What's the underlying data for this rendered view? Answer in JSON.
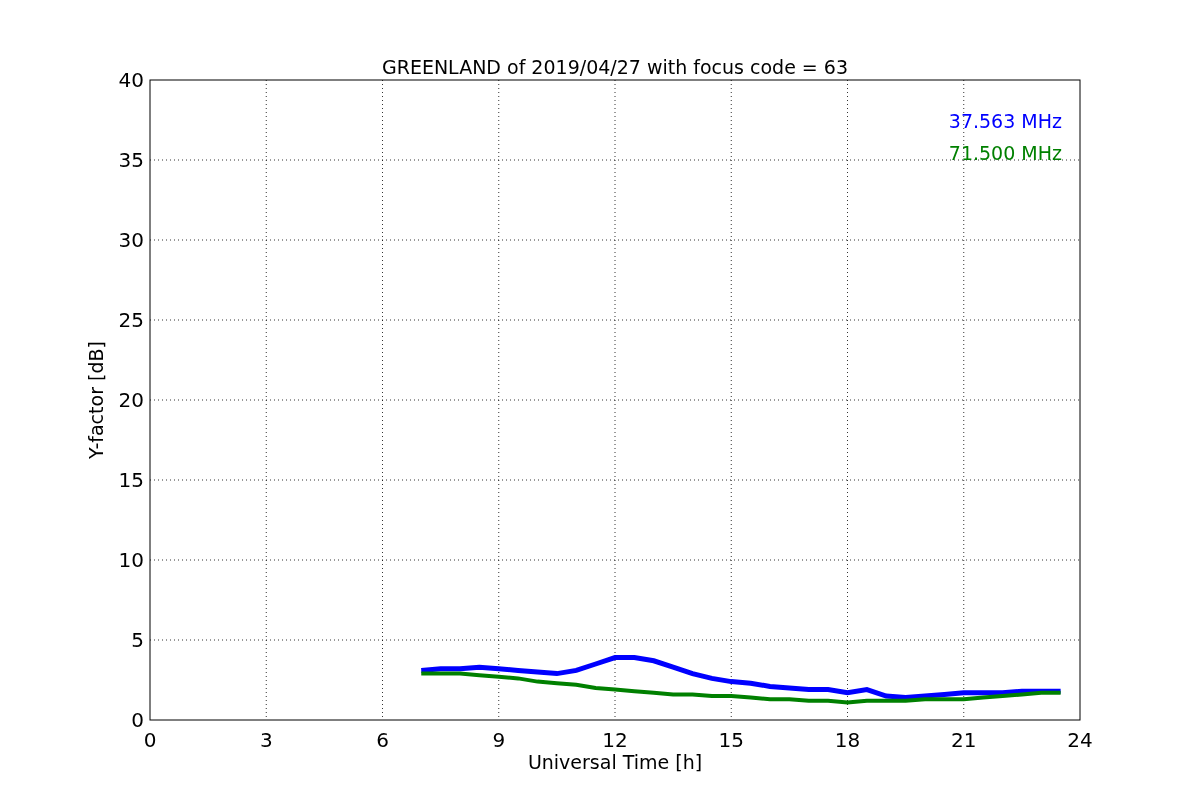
{
  "figure": {
    "chart_data": {
      "type": "line",
      "title": "GREENLAND of 2019/04/27 with focus code = 63",
      "xlabel": "Universal Time [h]",
      "ylabel": "Y-factor [dB]",
      "x": [
        7,
        7.5,
        8,
        8.5,
        9,
        9.5,
        10,
        10.5,
        11,
        11.5,
        12,
        12.5,
        13,
        13.5,
        14,
        14.5,
        15,
        15.5,
        16,
        16.5,
        17,
        17.5,
        18,
        18.5,
        19,
        19.5,
        20,
        20.5,
        21,
        21.5,
        22,
        22.5,
        23,
        23.5
      ],
      "series": [
        {
          "name": "37.563 MHz",
          "color": "#0000ff",
          "values": [
            3.1,
            3.2,
            3.2,
            3.3,
            3.2,
            3.1,
            3.0,
            2.9,
            3.1,
            3.5,
            3.9,
            3.9,
            3.7,
            3.3,
            2.9,
            2.6,
            2.4,
            2.3,
            2.1,
            2.0,
            1.9,
            1.9,
            1.7,
            1.9,
            1.5,
            1.4,
            1.5,
            1.6,
            1.7,
            1.7,
            1.7,
            1.8,
            1.8,
            1.8
          ]
        },
        {
          "name": "71.500 MHz",
          "color": "#008000",
          "values": [
            2.9,
            2.9,
            2.9,
            2.8,
            2.7,
            2.6,
            2.4,
            2.3,
            2.2,
            2.0,
            1.9,
            1.8,
            1.7,
            1.6,
            1.6,
            1.5,
            1.5,
            1.4,
            1.3,
            1.3,
            1.2,
            1.2,
            1.1,
            1.2,
            1.2,
            1.2,
            1.3,
            1.3,
            1.3,
            1.4,
            1.5,
            1.6,
            1.7,
            1.7
          ]
        }
      ],
      "grid": true,
      "xlim": [
        0,
        24
      ],
      "ylim": [
        0,
        40
      ],
      "xticks": [
        0,
        3,
        6,
        9,
        12,
        15,
        18,
        21,
        24
      ],
      "yticks": [
        0,
        5,
        10,
        15,
        20,
        25,
        30,
        35,
        40
      ]
    }
  }
}
